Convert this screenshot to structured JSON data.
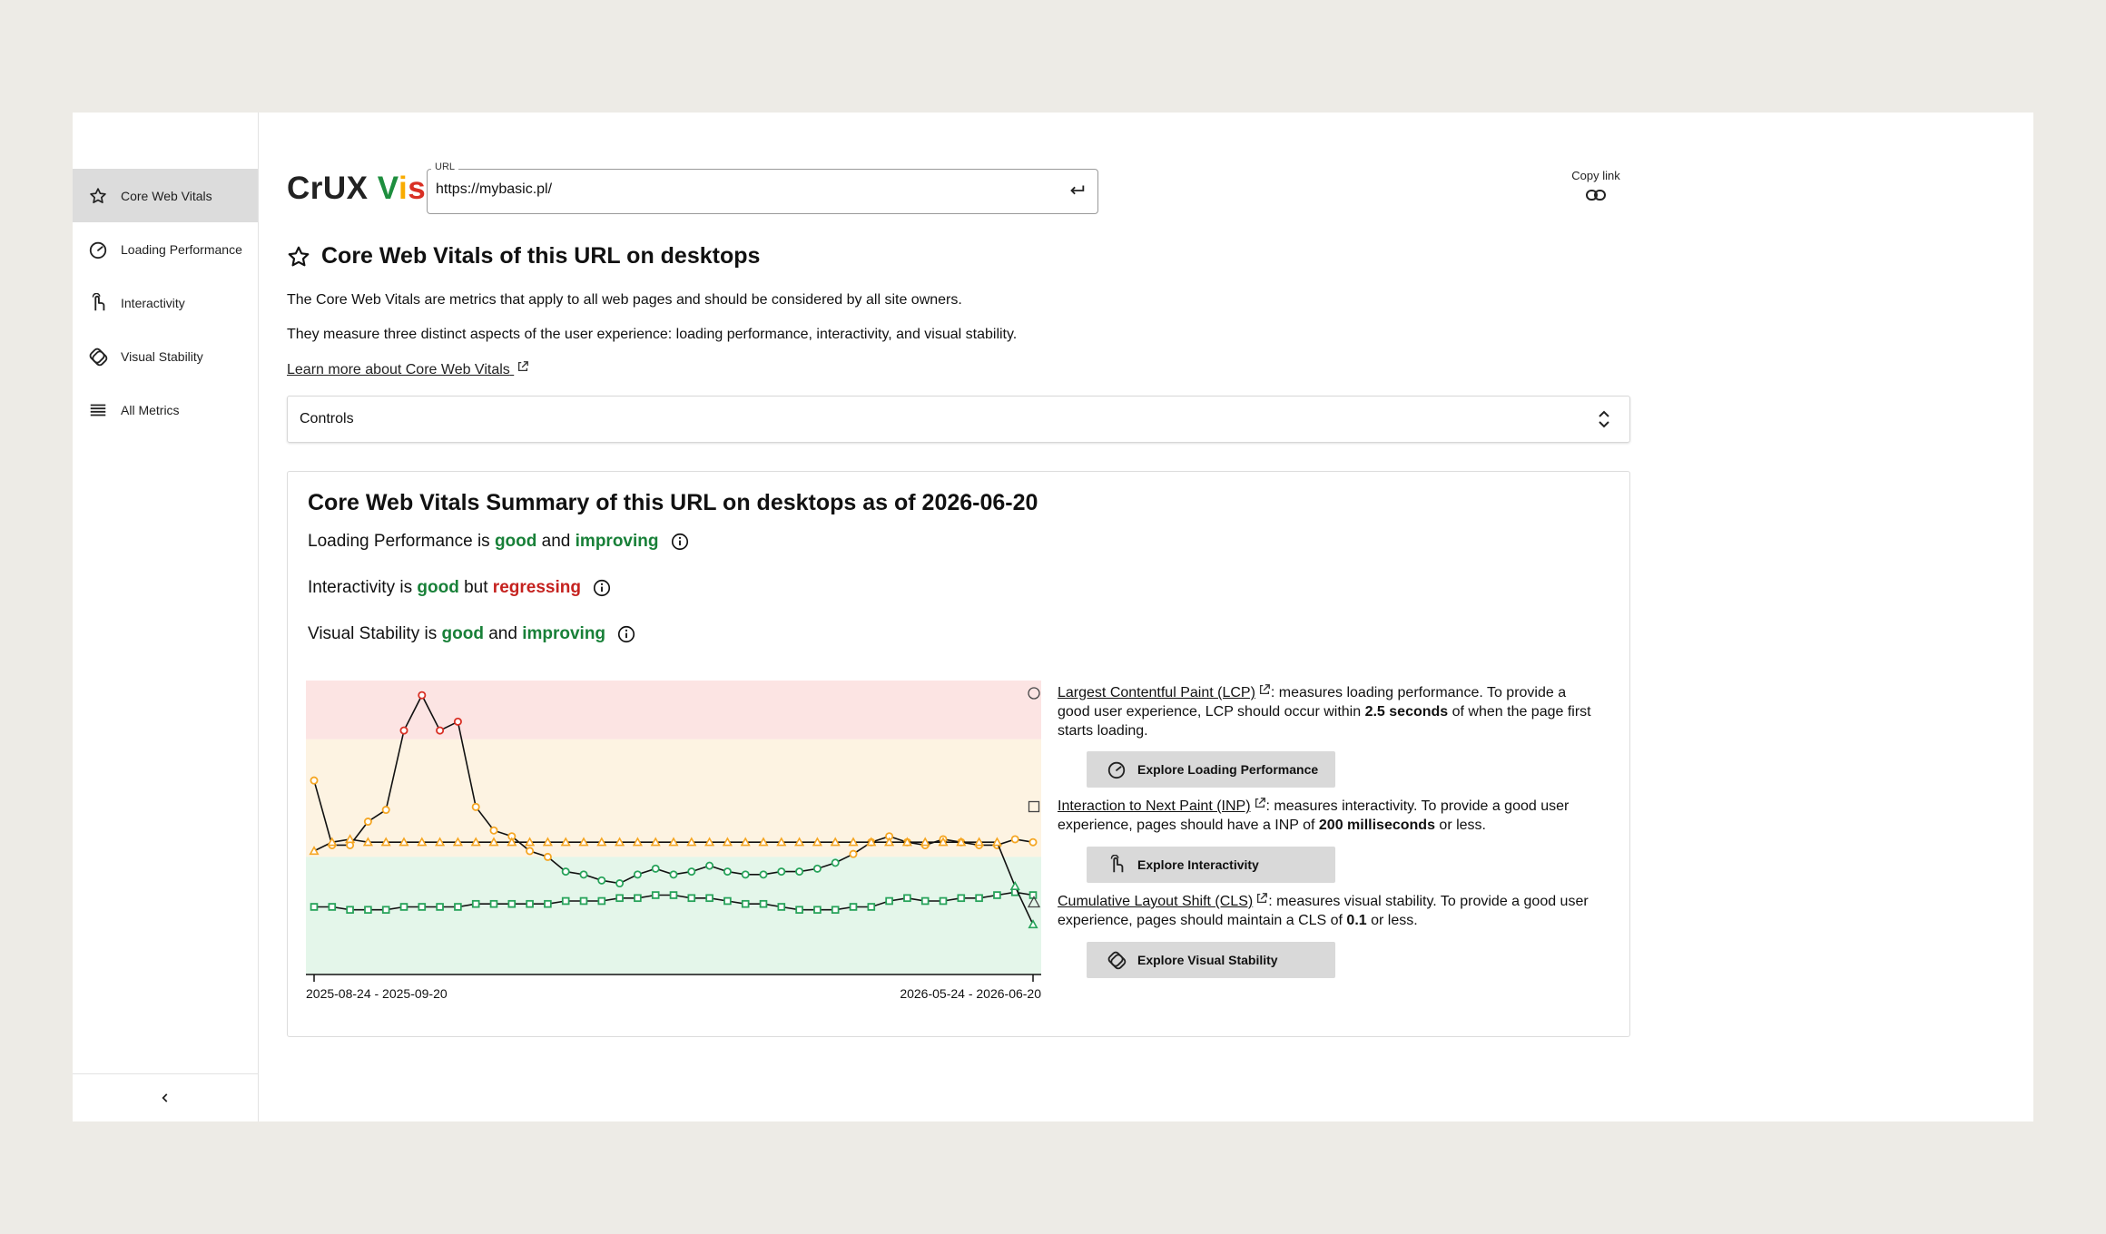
{
  "sidebar": {
    "items": [
      {
        "label": "Core Web Vitals",
        "icon": "star-icon",
        "active": true
      },
      {
        "label": "Loading Performance",
        "icon": "speedometer-icon",
        "active": false
      },
      {
        "label": "Interactivity",
        "icon": "pointer-hand-icon",
        "active": false
      },
      {
        "label": "Visual Stability",
        "icon": "layers-icon",
        "active": false
      },
      {
        "label": "All Metrics",
        "icon": "list-icon",
        "active": false
      }
    ],
    "collapse_icon": "chevron-left-icon"
  },
  "header": {
    "logo_crux": "CrUX ",
    "logo_v": "V",
    "logo_i": "i",
    "logo_s": "s",
    "url_label": "URL",
    "url_value": "https://mybasic.pl/",
    "copy_link_label": "Copy link"
  },
  "page": {
    "title": "Core Web Vitals of this URL on desktops",
    "desc1": "The Core Web Vitals are metrics that apply to all web pages and should be considered by all site owners.",
    "desc2": "They measure three distinct aspects of the user experience: loading performance, interactivity, and visual stability.",
    "learn_more": "Learn more about Core Web Vitals",
    "controls_label": "Controls"
  },
  "summary": {
    "title": "Core Web Vitals Summary of this URL on desktops as of 2026-06-20",
    "lines": [
      {
        "metric": "Loading Performance is ",
        "state": "good",
        "conj": " and ",
        "trend": "improving",
        "trend_good": true
      },
      {
        "metric": "Interactivity is ",
        "state": "good",
        "conj": " but ",
        "trend": "regressing",
        "trend_good": false
      },
      {
        "metric": "Visual Stability is ",
        "state": "good",
        "conj": " and ",
        "trend": "improving",
        "trend_good": true
      }
    ]
  },
  "legend": {
    "lcp": {
      "link": "Largest Contentful Paint (LCP)",
      "text1": ": measures loading performance. To provide a good user experience, LCP should occur within ",
      "bold": "2.5 seconds",
      "text2": " of when the page first starts loading.",
      "button": "Explore Loading Performance"
    },
    "inp": {
      "link": "Interaction to Next Paint (INP)",
      "text1": ": measures interactivity. To provide a good user experience, pages should have a INP of ",
      "bold": "200 milliseconds",
      "text2": " or less.",
      "button": "Explore Interactivity"
    },
    "cls": {
      "link": "Cumulative Layout Shift (CLS)",
      "text1": ": measures visual stability. To provide a good user experience, pages should maintain a CLS of ",
      "bold": "0.1",
      "text2": " or less.",
      "button": "Explore Visual Stability"
    }
  },
  "chart_data": {
    "type": "line",
    "x_tick_labels": [
      "2025-08-24 - 2025-09-20",
      "2026-05-24 - 2026-06-20"
    ],
    "y_scale": "normalized score (lower is better)",
    "ylim": [
      0,
      100
    ],
    "bands": [
      {
        "name": "poor",
        "from": 80,
        "to": 100,
        "color": "#fce4e3"
      },
      {
        "name": "needs-improvement",
        "from": 40,
        "to": 80,
        "color": "#fdf3e2"
      },
      {
        "name": "good",
        "from": 0,
        "to": 40,
        "color": "#e4f6ea"
      }
    ],
    "series": [
      {
        "marker": "circle",
        "stroke": "#111111",
        "values": [
          66,
          44,
          44,
          52,
          56,
          83,
          95,
          83,
          86,
          57,
          49,
          47,
          42,
          40,
          35,
          34,
          32,
          31,
          34,
          36,
          34,
          35,
          37,
          35,
          34,
          34,
          35,
          35,
          36,
          38,
          41,
          45,
          47,
          45,
          44,
          46,
          45,
          44,
          44,
          46,
          45
        ]
      },
      {
        "marker": "square",
        "stroke": "#111111",
        "values": [
          23,
          23,
          22,
          22,
          22,
          23,
          23,
          23,
          23,
          24,
          24,
          24,
          24,
          24,
          25,
          25,
          25,
          26,
          26,
          27,
          27,
          26,
          26,
          25,
          24,
          24,
          23,
          22,
          22,
          22,
          23,
          23,
          25,
          26,
          25,
          25,
          26,
          26,
          27,
          28,
          27
        ]
      },
      {
        "marker": "triangle",
        "stroke": "#111111",
        "values": [
          42,
          45,
          46,
          45,
          45,
          45,
          45,
          45,
          45,
          45,
          45,
          45,
          45,
          45,
          45,
          45,
          45,
          45,
          45,
          45,
          45,
          45,
          45,
          45,
          45,
          45,
          45,
          45,
          45,
          45,
          45,
          45,
          45,
          45,
          45,
          45,
          45,
          45,
          45,
          30,
          17
        ]
      }
    ],
    "colors": {
      "good": "#27a35a",
      "needs_improvement": "#f5a623",
      "poor": "#d93025"
    }
  }
}
